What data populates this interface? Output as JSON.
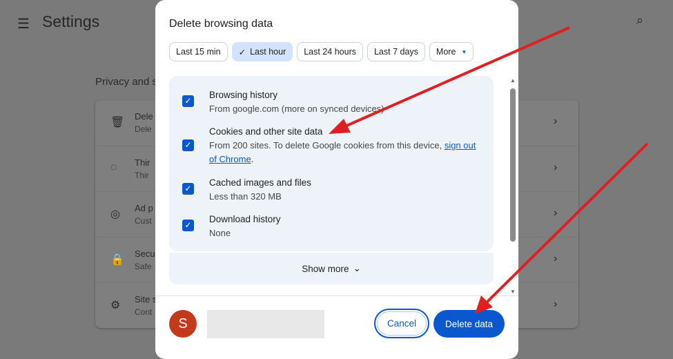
{
  "settings": {
    "title": "Settings",
    "section": "Privacy and s",
    "rows": [
      {
        "title": "Dele",
        "sub": "Dele"
      },
      {
        "title": "Thir",
        "sub": "Thir"
      },
      {
        "title": "Ad p",
        "sub": "Cust"
      },
      {
        "title": "Secu",
        "sub": "Safe"
      },
      {
        "title": "Site s",
        "sub": "Cont"
      }
    ]
  },
  "dialog": {
    "title": "Delete browsing data",
    "chips": [
      {
        "label": "Last 15 min"
      },
      {
        "label": "Last hour",
        "selected": true
      },
      {
        "label": "Last 24 hours"
      },
      {
        "label": "Last 7 days"
      },
      {
        "label": "More"
      }
    ],
    "items": [
      {
        "title": "Browsing history",
        "sub": "From google.com (more on synced devices)",
        "checked": true
      },
      {
        "title": "Cookies and other site data",
        "sub": "From 200 sites. To delete Google cookies from this device, ",
        "link": "sign out of Chrome",
        "after": ".",
        "checked": true
      },
      {
        "title": "Cached images and files",
        "sub": "Less than 320 MB",
        "checked": true
      },
      {
        "title": "Download history",
        "sub": "None",
        "checked": true
      }
    ],
    "show_more": "Show more",
    "avatar_letter": "S",
    "cancel": "Cancel",
    "delete": "Delete data"
  },
  "colors": {
    "accent": "#0b57d0",
    "arrow": "#e02020",
    "avatar": "#c2391b"
  }
}
